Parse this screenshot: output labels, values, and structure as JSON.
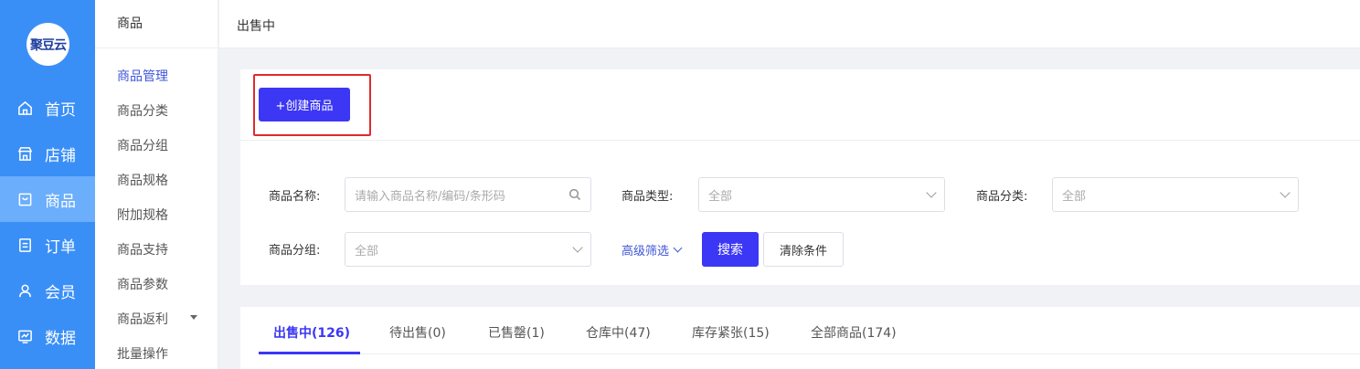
{
  "logo": {
    "text": "聚豆云"
  },
  "nav": [
    {
      "label": "首页",
      "icon": "home-icon"
    },
    {
      "label": "店铺",
      "icon": "store-icon"
    },
    {
      "label": "商品",
      "icon": "goods-icon",
      "active": true
    },
    {
      "label": "订单",
      "icon": "order-icon"
    },
    {
      "label": "会员",
      "icon": "member-icon"
    },
    {
      "label": "数据",
      "icon": "data-icon"
    }
  ],
  "subnav": {
    "title": "商品",
    "items": [
      {
        "label": "商品管理",
        "active": true
      },
      {
        "label": "商品分类"
      },
      {
        "label": "商品分组"
      },
      {
        "label": "商品规格"
      },
      {
        "label": "附加规格"
      },
      {
        "label": "商品支持"
      },
      {
        "label": "商品参数"
      },
      {
        "label": "商品返利",
        "has_caret": true
      },
      {
        "label": "批量操作"
      }
    ]
  },
  "header": {
    "breadcrumb": "出售中"
  },
  "toolbar": {
    "create_label": "+创建商品"
  },
  "filters": {
    "name": {
      "label": "商品名称:",
      "placeholder": "请输入商品名称/编码/条形码"
    },
    "type": {
      "label": "商品类型:",
      "value": "全部"
    },
    "category": {
      "label": "商品分类:",
      "value": "全部"
    },
    "group": {
      "label": "商品分组:",
      "value": "全部"
    },
    "advanced_label": "高级筛选",
    "search_label": "搜索",
    "clear_label": "清除条件"
  },
  "tabs": [
    {
      "label": "出售中(126)",
      "active": true
    },
    {
      "label": "待出售(0)"
    },
    {
      "label": "已售罄(1)"
    },
    {
      "label": "仓库中(47)"
    },
    {
      "label": "库存紧张(15)"
    },
    {
      "label": "全部商品(174)"
    }
  ],
  "colors": {
    "sidebar": "#3a8ff7",
    "accent": "#3b37f5",
    "highlight": "#e02a2a"
  }
}
